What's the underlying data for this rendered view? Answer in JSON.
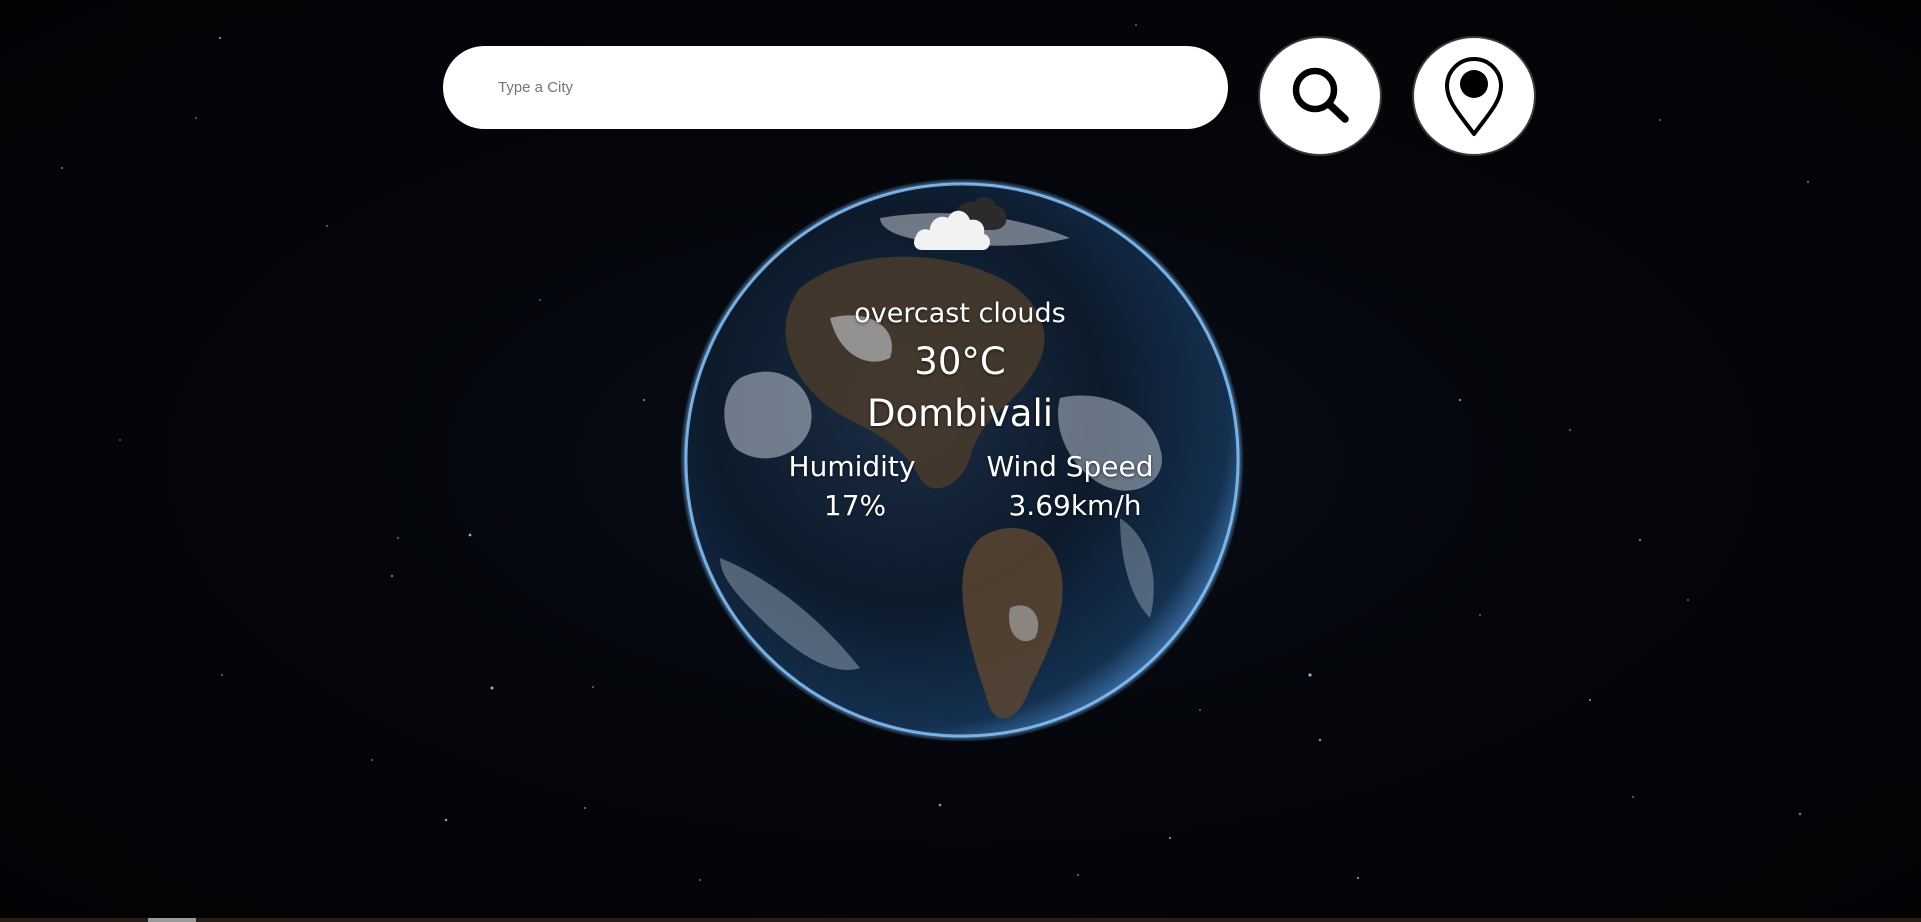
{
  "search": {
    "placeholder": "Type a City",
    "value": ""
  },
  "buttons": {
    "search_icon": "search-icon",
    "location_icon": "location-pin-icon"
  },
  "weather": {
    "icon": "overcast-cloud-icon",
    "description": "overcast clouds",
    "temperature": "30°C",
    "city": "Dombivali",
    "humidity_label": "Humidity",
    "humidity_value": "17%",
    "wind_label": "Wind Speed",
    "wind_value": "3.69km/h"
  },
  "colors": {
    "background": "#03050a",
    "text": "#ffffff",
    "input_background": "#ffffff",
    "atmosphere": "#6fb6ff"
  }
}
